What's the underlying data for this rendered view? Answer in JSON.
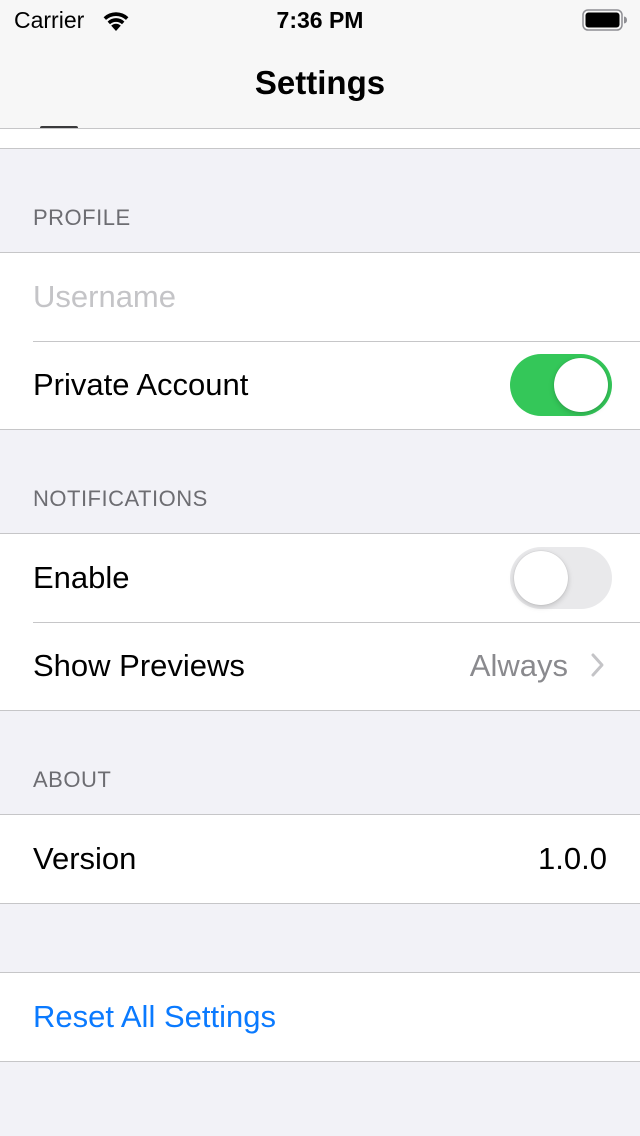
{
  "status_bar": {
    "carrier": "Carrier",
    "time": "7:36 PM",
    "wifi_icon": "wifi-icon",
    "battery_icon": "battery-icon"
  },
  "nav": {
    "title": "Settings"
  },
  "sections": {
    "profile": {
      "header": "PROFILE",
      "username_placeholder": "Username",
      "username_value": "",
      "private_account_label": "Private Account",
      "private_account_on": true
    },
    "notifications": {
      "header": "NOTIFICATIONS",
      "enable_label": "Enable",
      "enable_on": false,
      "show_previews_label": "Show Previews",
      "show_previews_value": "Always",
      "show_previews_icon": "chevron-right-icon"
    },
    "about": {
      "header": "ABOUT",
      "version_label": "Version",
      "version_value": "1.0.0"
    },
    "reset": {
      "label": "Reset All Settings"
    }
  },
  "colors": {
    "accent": "#0a7aff",
    "toggle_on": "#34c759",
    "toggle_off": "#e9e9eb",
    "background": "#f2f2f7",
    "secondary_text": "#6d6d72"
  }
}
